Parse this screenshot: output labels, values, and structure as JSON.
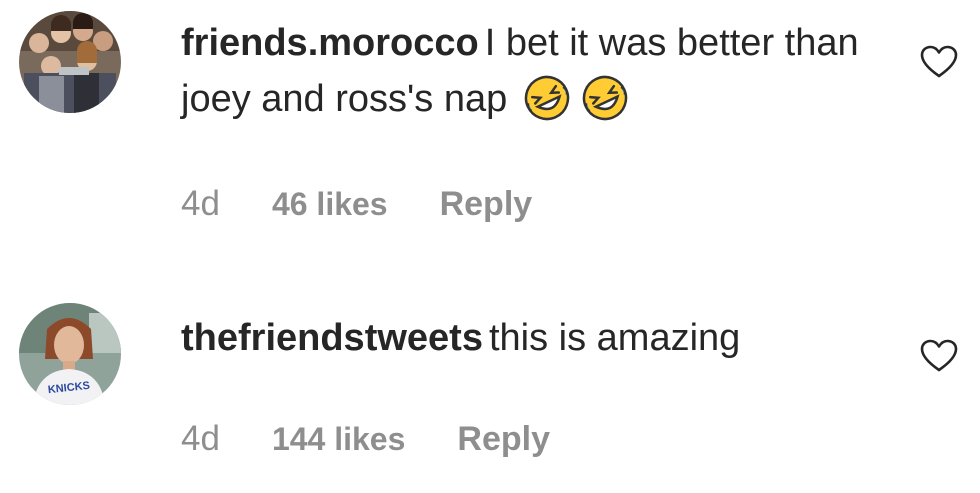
{
  "comments": [
    {
      "username": "friends.morocco",
      "text": "I bet it was better than joey and ross's nap",
      "emojis": [
        "rolling-on-floor-laughing-emoji",
        "rolling-on-floor-laughing-emoji"
      ],
      "time": "4d",
      "likes": "46 likes",
      "reply_label": "Reply",
      "avatar": "friends-cast-group-avatar",
      "like_icon": "heart-outline-icon"
    },
    {
      "username": "thefriendstweets",
      "text": "this is amazing",
      "time": "4d",
      "likes": "144 likes",
      "reply_label": "Reply",
      "avatar": "ross-knicks-shirt-avatar",
      "like_icon": "heart-outline-icon"
    }
  ],
  "colors": {
    "text": "#262626",
    "meta": "#8e8e8e",
    "emoji_face": "#ffcc33",
    "emoji_tears": "#4fb3e6"
  }
}
